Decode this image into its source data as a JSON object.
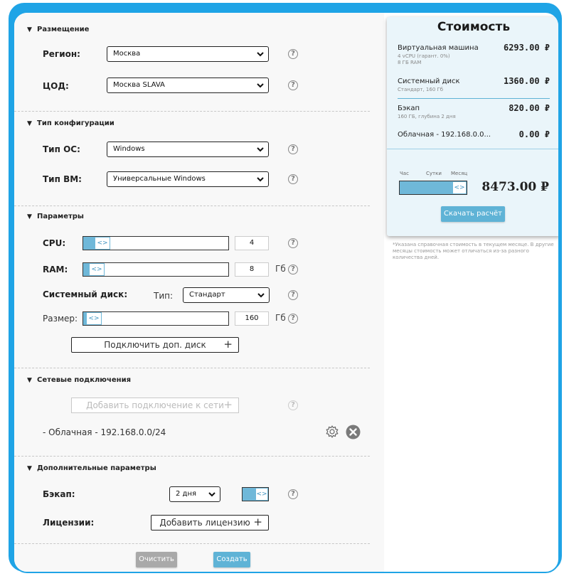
{
  "placement": {
    "title": "Размещение",
    "region_label": "Регион:",
    "region_value": "Москва",
    "dc_label": "ЦОД:",
    "dc_value": "Москва SLAVA"
  },
  "config": {
    "title": "Тип конфигурации",
    "os_label": "Тип ОС:",
    "os_value": "Windows",
    "vm_label": "Тип ВМ:",
    "vm_value": "Универсальные Windows"
  },
  "params": {
    "title": "Параметры",
    "cpu_label": "CPU:",
    "cpu_value": "4",
    "ram_label": "RAM:",
    "ram_value": "8",
    "ram_unit": "Гб",
    "disk_label": "Системный диск:",
    "disk_type_label": "Тип:",
    "disk_type_value": "Стандарт",
    "size_label": "Размер:",
    "size_value": "160",
    "size_unit": "Гб",
    "add_disk_label": "Подключить доп. диск"
  },
  "network": {
    "title": "Сетевые подключения",
    "add_label": "Добавить подключение к сети",
    "item": "- Облачная - 192.168.0.0/24"
  },
  "extra": {
    "title": "Дополнительные параметры",
    "backup_label": "Бэкап:",
    "backup_value": "2 дня",
    "license_label": "Лицензии:",
    "license_button": "Добавить лицензию"
  },
  "actions": {
    "clear": "Очистить",
    "create": "Создать"
  },
  "cost": {
    "title": "Стоимость",
    "rows": [
      {
        "name": "Виртуальная машина",
        "sub1": "4 vCPU (гарант. 0%)",
        "sub2": "8 ГБ RAM",
        "price": "6293.00 ₽"
      },
      {
        "name": "Системный диск",
        "sub1": "Стандарт, 160 Гб",
        "price": "1360.00 ₽"
      },
      {
        "name": "Бэкап",
        "sub1": "160 ГБ, глубина 2 дня",
        "price": "820.00 ₽"
      },
      {
        "name": "Облачная - 192.168.0.0...",
        "price": "0.00 ₽"
      }
    ],
    "period_hour": "Час",
    "period_day": "Сутки",
    "period_month": "Месяц",
    "total": "8473.00 ₽",
    "download": "Скачать расчёт",
    "note": "*Указана справочная стоимость в текущем месяце. В другие месяцы стоимость может отличаться из-за разного количества дней."
  },
  "colors": {
    "accent": "#1fa4e6",
    "slider": "#6fb8d9",
    "button": "#5fb3d6"
  }
}
